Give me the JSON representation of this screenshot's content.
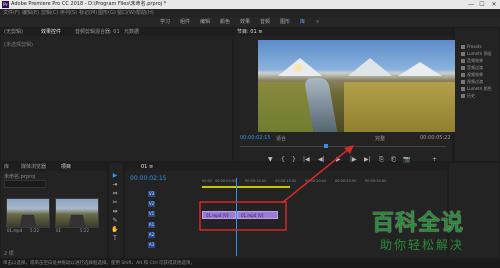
{
  "titlebar": {
    "app_badge": "Pr",
    "title": "Adobe Premiere Pro CC 2018 - D:\\Program Files\\未命名.prproj *",
    "minimize": "—",
    "maximize": "☐",
    "close": "✕"
  },
  "menu": [
    "文件(F)",
    "编辑(E)",
    "剪辑(C)",
    "序列(S)",
    "标记(M)",
    "图形(G)",
    "窗口(W)",
    "帮助(H)"
  ],
  "workspaces": [
    "学习",
    "组件",
    "编辑",
    "颜色",
    "效果",
    "音频",
    "图形",
    "库",
    "»"
  ],
  "source_panel": {
    "tabs": [
      "(无剪辑)",
      "效果控件",
      "音频剪辑混合器: 01",
      "元数据"
    ],
    "empty_text": "(未选择剪辑)"
  },
  "program": {
    "title": "节目: 01 ≡",
    "timecode_left": "00:00:02:15",
    "timecode_right": "00:00:05:22",
    "fit": "适合",
    "quality": "完整",
    "controls": [
      "▼",
      "{",
      "}",
      "|◀",
      "◀|",
      "▶",
      "|▶",
      "▶|",
      "⎘",
      "⎗",
      "📷",
      "+"
    ]
  },
  "project": {
    "tabs": [
      "项目",
      "媒体浏览器",
      "库",
      "信息",
      "效果",
      "标记",
      "历史记录"
    ],
    "filename": "未命名.prproj",
    "items": [
      {
        "name": "01.mp4",
        "duration": "5:22"
      },
      {
        "name": "01",
        "duration": "5:22"
      }
    ],
    "footer_count": "2 项"
  },
  "right_panel": {
    "items": [
      "Presets",
      "Lumetri 预设",
      "音频效果",
      "音频过渡",
      "视频效果",
      "视频过渡",
      "Lumetri 颜色",
      "历史"
    ]
  },
  "timeline": {
    "tab": "01 ≡",
    "timecode": "00:00:02:15",
    "ruler": [
      "00:00",
      "00:00:05:00",
      "00:00:10:00",
      "00:00:15:00",
      "00:00:20:00",
      "00:00:25:00",
      "00:00:30:00"
    ],
    "tracks": [
      "V3",
      "V2",
      "V1",
      "A1",
      "A2",
      "A3"
    ],
    "clips": [
      "01.mp4 [V]",
      "01.mp4 [V]"
    ]
  },
  "tools": [
    "▶",
    "⇥",
    "⇔",
    "✂",
    "⇹",
    "✎",
    "✋",
    "T"
  ],
  "watermark": {
    "title": "百科全说",
    "subtitle": "助你轻松解决"
  },
  "status": "单击以选择，或单击空白处并拖动以进行选择框选择。使用 Shift、Alt 和 Ctrl 可获得其他选项。",
  "colors": {
    "accent": "#3a8ee6",
    "clip": "#9c7ad8",
    "annotation": "#d62828",
    "watermark": "#2a8a3a"
  }
}
